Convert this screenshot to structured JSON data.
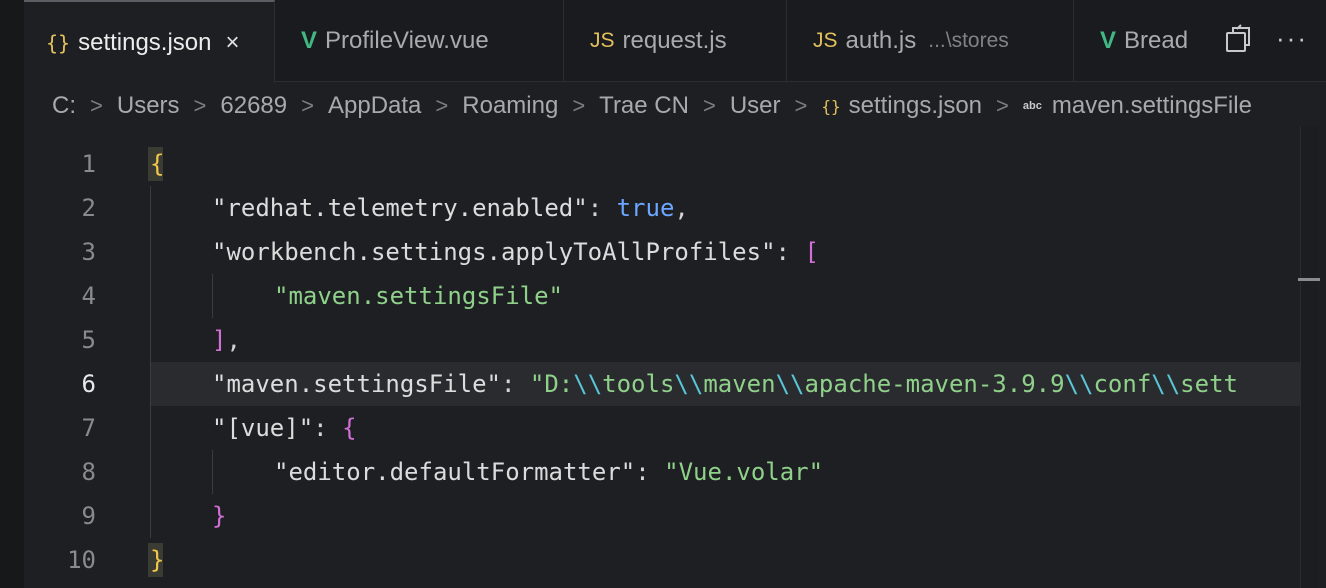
{
  "tabs": [
    {
      "icon": "{}",
      "label": "settings.json",
      "close": "×",
      "active": true
    },
    {
      "icon": "V",
      "label": "ProfileView.vue"
    },
    {
      "icon": "JS",
      "label": "request.js"
    },
    {
      "icon": "JS",
      "label": "auth.js",
      "description": "...\\stores"
    },
    {
      "icon": "V",
      "label": "Bread"
    }
  ],
  "toolbar": {
    "split_icon": "split-editor-icon",
    "more": "···"
  },
  "breadcrumb": {
    "items": [
      "C:",
      "Users",
      "62689",
      "AppData",
      "Roaming",
      "Trae CN",
      "User"
    ],
    "file_icon": "{}",
    "file": "settings.json",
    "symbol_icon": "abc",
    "symbol": "maven.settingsFile",
    "separator": ">"
  },
  "editor": {
    "current_line": 6,
    "line_numbers": [
      "1",
      "2",
      "3",
      "4",
      "5",
      "6",
      "7",
      "8",
      "9",
      "10"
    ],
    "code": {
      "l1_open": "{",
      "l2_key": "\"redhat.telemetry.enabled\"",
      "l2_colon": ": ",
      "l2_val": "true",
      "l2_comma": ",",
      "l3_key": "\"workbench.settings.applyToAllProfiles\"",
      "l3_colon": ": ",
      "l3_open": "[",
      "l4_val": "\"maven.settingsFile\"",
      "l5_close": "]",
      "l5_comma": ",",
      "l6_key": "\"maven.settingsFile\"",
      "l6_colon": ": ",
      "l6_q": "\"D:",
      "l6_e1": "\\\\",
      "l6_p1": "tools",
      "l6_e2": "\\\\",
      "l6_p2": "maven",
      "l6_e3": "\\\\",
      "l6_p3": "apache-maven-3.9.9",
      "l6_e4": "\\\\",
      "l6_p4": "conf",
      "l6_e5": "\\\\",
      "l6_p5": "sett",
      "l7_key": "\"[vue]\"",
      "l7_colon": ": ",
      "l7_open": "{",
      "l8_key": "\"editor.defaultFormatter\"",
      "l8_colon": ": ",
      "l8_val": "\"Vue.volar\"",
      "l9_close": "}",
      "l10_close": "}"
    }
  },
  "colors": {
    "accent_vue": "#41b883",
    "accent_js": "#e2c05d",
    "string": "#8fd18a",
    "keyword": "#6ba6ff"
  }
}
